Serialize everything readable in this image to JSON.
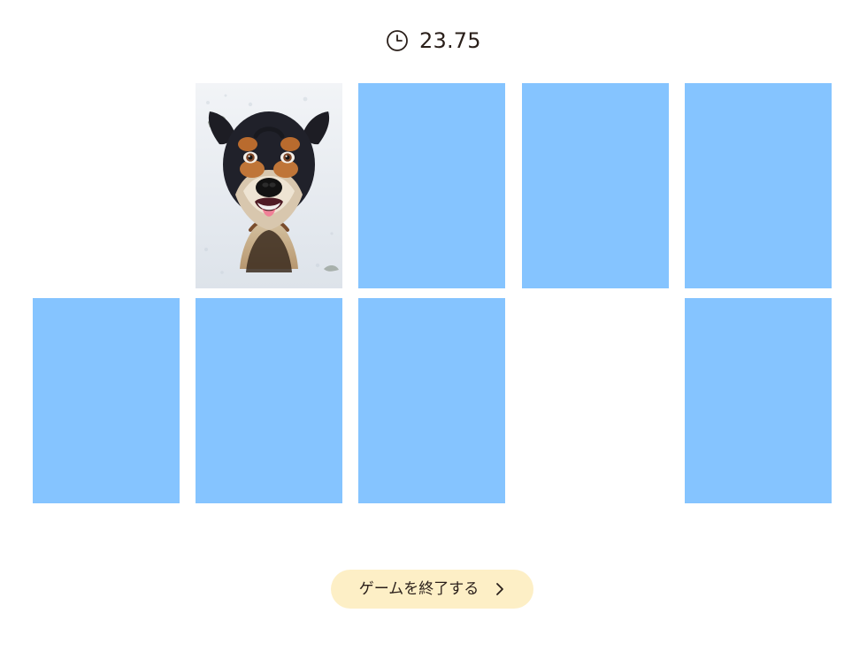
{
  "timer": {
    "icon": "clock-icon",
    "value": "23.75"
  },
  "board": {
    "rows": 2,
    "cols": 5,
    "card_back_color": "#85c4ff",
    "cards": [
      {
        "row": 1,
        "col": 1,
        "state": "matched"
      },
      {
        "row": 1,
        "col": 2,
        "state": "revealed",
        "image": "dog-photo"
      },
      {
        "row": 1,
        "col": 3,
        "state": "face-down"
      },
      {
        "row": 1,
        "col": 4,
        "state": "face-down"
      },
      {
        "row": 1,
        "col": 5,
        "state": "face-down"
      },
      {
        "row": 2,
        "col": 1,
        "state": "face-down"
      },
      {
        "row": 2,
        "col": 2,
        "state": "face-down"
      },
      {
        "row": 2,
        "col": 3,
        "state": "face-down"
      },
      {
        "row": 2,
        "col": 4,
        "state": "matched"
      },
      {
        "row": 2,
        "col": 5,
        "state": "face-down"
      }
    ]
  },
  "actions": {
    "finish_label": "ゲームを終了する",
    "finish_icon": "chevron-right-icon",
    "finish_button_color": "#fdefc6"
  }
}
